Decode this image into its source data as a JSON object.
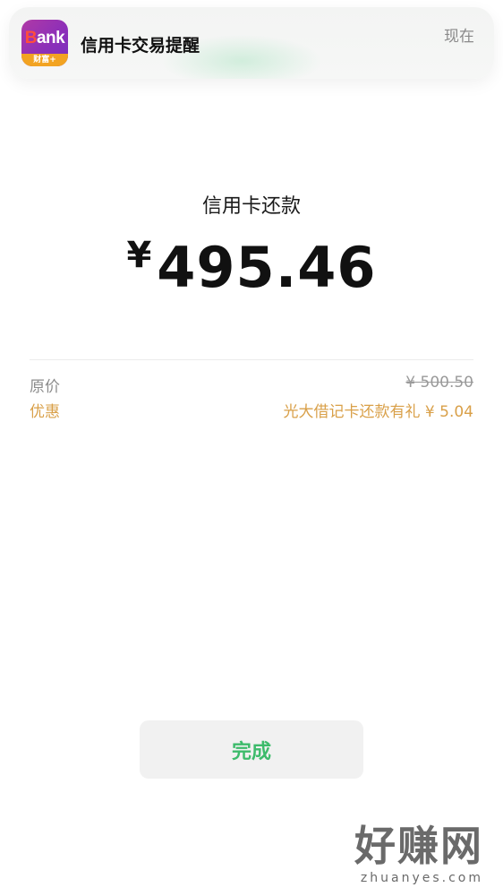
{
  "notification": {
    "app_icon": {
      "icon": "bank-app-icon",
      "text_prefix": "B",
      "text_rest": "ank",
      "badge": "财富+",
      "colors": {
        "gradient_start": "#b03aa6",
        "gradient_end": "#7a2fc0",
        "badge": "#f2a322"
      }
    },
    "title": "信用卡交易提醒",
    "time": "现在"
  },
  "transaction": {
    "title": "信用卡还款",
    "currency_symbol": "¥",
    "amount": "495.46"
  },
  "details": [
    {
      "label": "原价",
      "value": "¥ 500.50"
    },
    {
      "label": "优惠",
      "value": "光大借记卡还款有礼 ¥ 5.04"
    }
  ],
  "actions": {
    "done_label": "完成"
  },
  "watermark": {
    "text": "好赚网",
    "url": "zhuanyes.com"
  },
  "colors": {
    "accent_green": "#3dbb6b",
    "discount_gold": "#d9a049"
  }
}
